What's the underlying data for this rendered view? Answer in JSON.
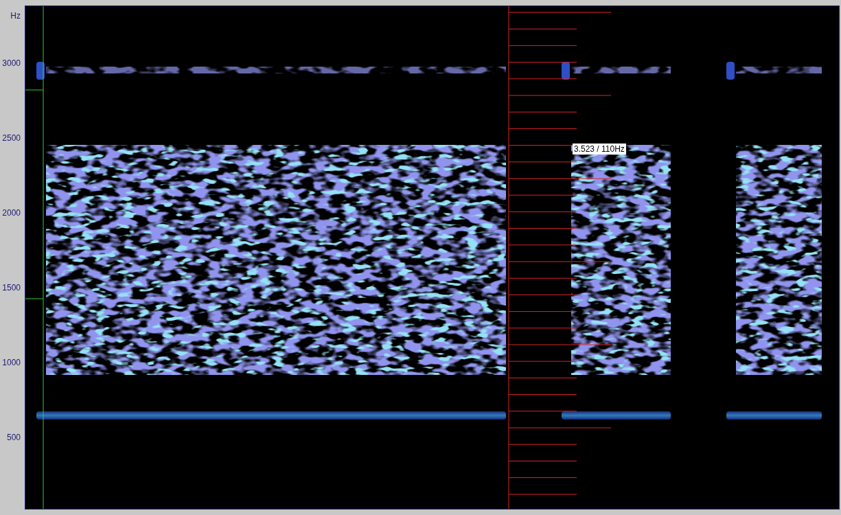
{
  "y_axis": {
    "unit": "Hz",
    "ticks": [
      "3000",
      "2500",
      "2000",
      "1500",
      "1000",
      "500"
    ]
  },
  "cursor": {
    "readout": "3.523 / 110Hz"
  }
}
